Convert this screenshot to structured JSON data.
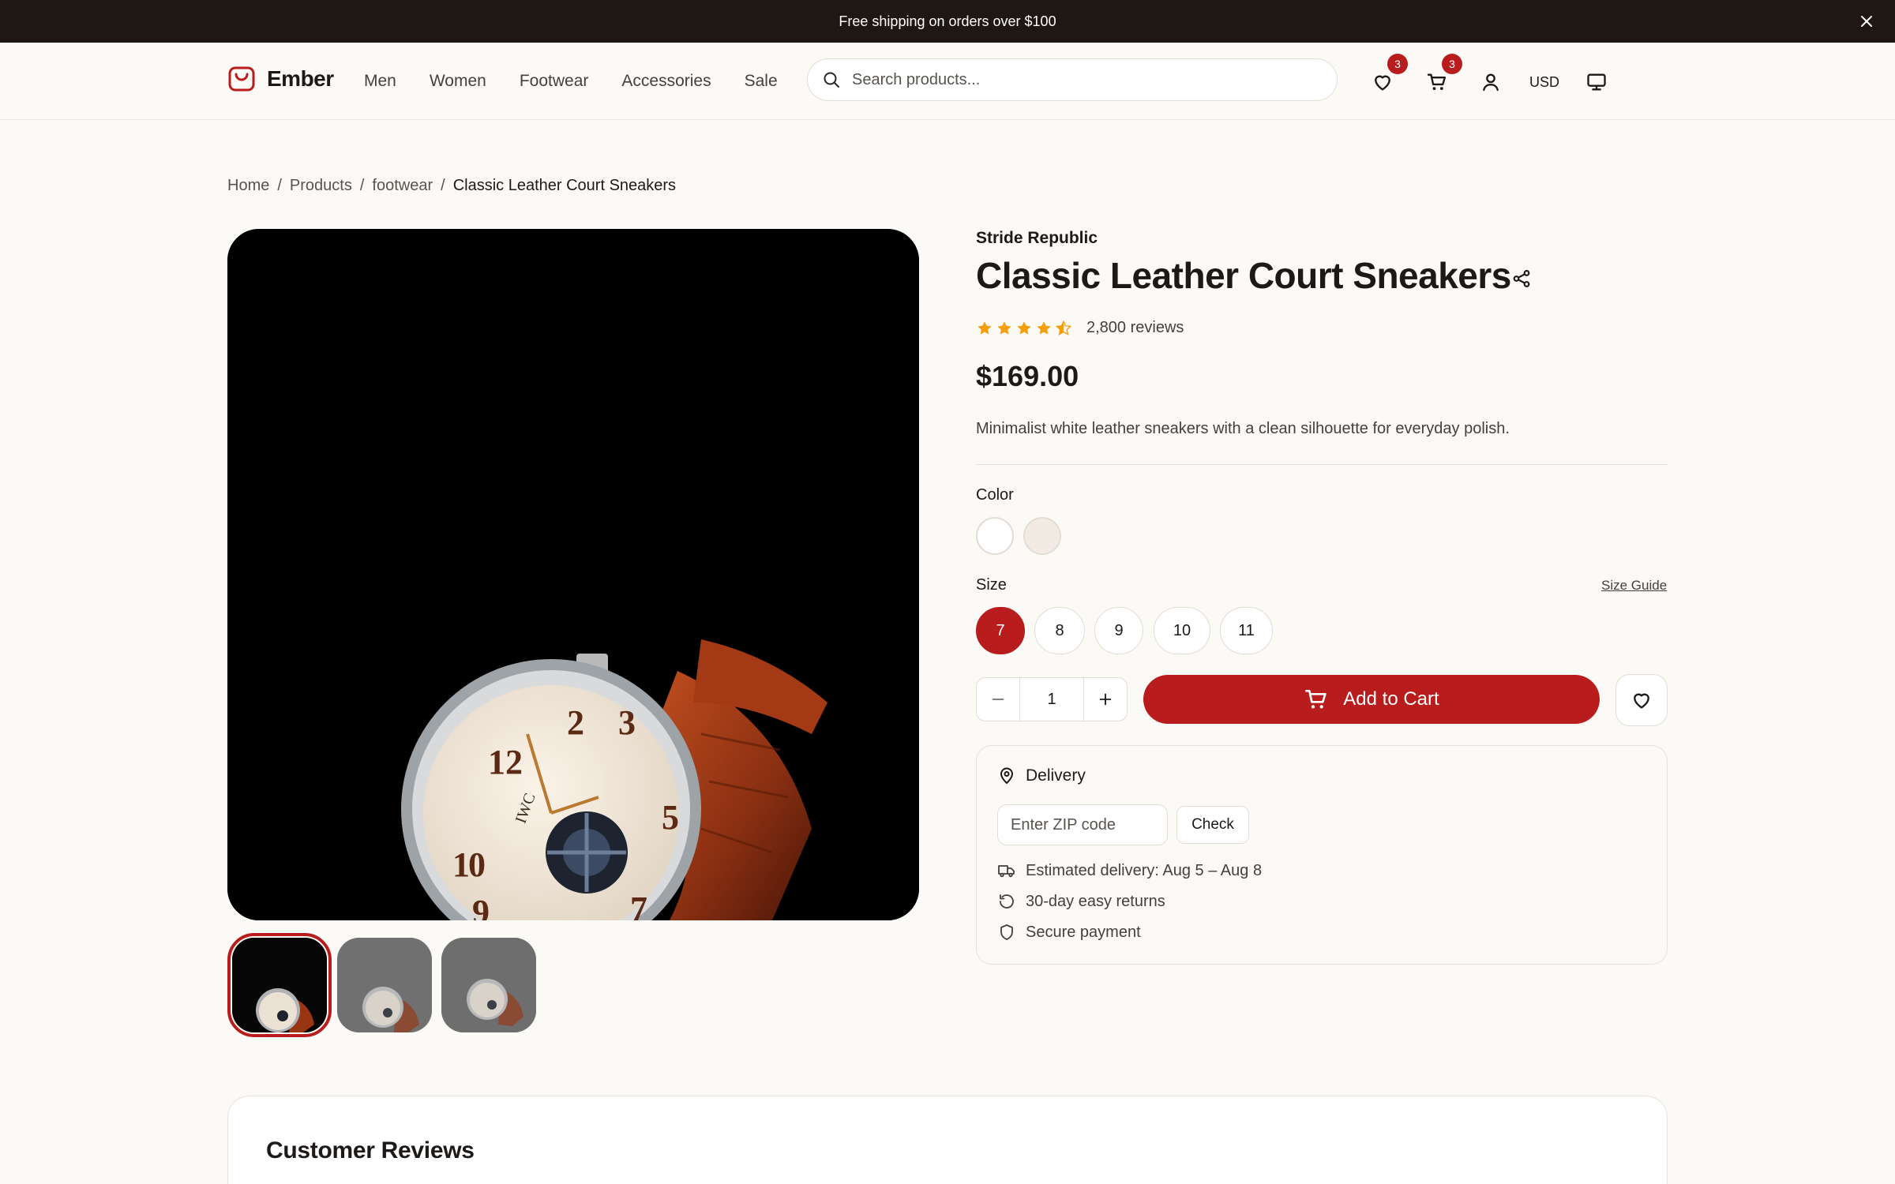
{
  "announcement": {
    "text": "Free shipping on orders over $100"
  },
  "header": {
    "logo_text": "Ember",
    "nav": [
      "Men",
      "Women",
      "Footwear",
      "Accessories",
      "Sale"
    ],
    "search_placeholder": "Search products...",
    "wishlist_count": "3",
    "cart_count": "3",
    "currency": "USD"
  },
  "breadcrumb": [
    "Home",
    "Products",
    "footwear",
    "Classic Leather Court Sneakers"
  ],
  "product": {
    "brand": "Stride Republic",
    "title": "Classic Leather Court Sneakers",
    "rating": 4.5,
    "reviews": "2,800 reviews",
    "price": "$169.00",
    "description": "Minimalist white leather sneakers with a clean silhouette for everyday polish.",
    "color_label": "Color",
    "colors": [
      "#ffffff",
      "#f1ebe4"
    ],
    "size_label": "Size",
    "size_guide": "Size Guide",
    "sizes": [
      "7",
      "8",
      "9",
      "10",
      "11"
    ],
    "selected_size": "7",
    "quantity": "1",
    "add_to_cart": "Add to Cart"
  },
  "delivery": {
    "title": "Delivery",
    "zip_placeholder": "Enter ZIP code",
    "check": "Check",
    "estimated": "Estimated delivery: Aug 5 – Aug 8",
    "returns": "30-day easy returns",
    "secure": "Secure payment"
  },
  "reviews_section": {
    "title": "Customer Reviews"
  },
  "colors": {
    "accent": "#b91c1c",
    "star": "#f59e0b",
    "announce_bg": "#1f1714"
  }
}
